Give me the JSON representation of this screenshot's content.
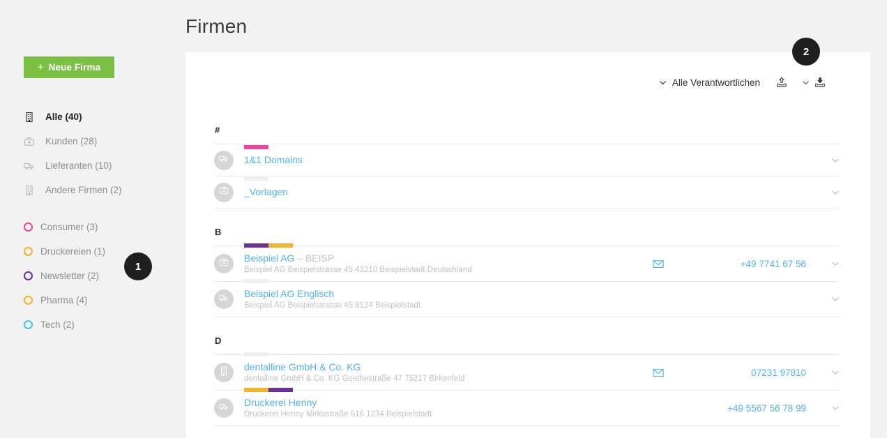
{
  "header": {
    "title": "Firmen"
  },
  "sidebar": {
    "new_button": {
      "label": "Neue Firma",
      "plus": "+",
      "color": "#7ac143"
    },
    "primary_items": [
      {
        "label": "Alle (40)",
        "icon": "building-icon",
        "active": true
      },
      {
        "label": "Kunden (28)",
        "icon": "briefcase-icon",
        "active": false
      },
      {
        "label": "Lieferanten (10)",
        "icon": "truck-icon",
        "active": false
      },
      {
        "label": "Andere Firmen (2)",
        "icon": "building-icon",
        "active": false
      }
    ],
    "tag_items": [
      {
        "label": "Consumer (3)",
        "color": "#ef44a1"
      },
      {
        "label": "Druckereien (1)",
        "color": "#f5b327"
      },
      {
        "label": "Newsletter (2)",
        "color": "#6b2fa0"
      },
      {
        "label": "Pharma (4)",
        "color": "#f5b327"
      },
      {
        "label": "Tech (2)",
        "color": "#3fc5f0"
      }
    ]
  },
  "badges": [
    {
      "label": "1",
      "name": "annotation-badge-1"
    },
    {
      "label": "2",
      "name": "annotation-badge-2"
    }
  ],
  "toolbar": {
    "responsible_filter": "Alle Verantwortlichen",
    "chevron_icon": "chevron-down-icon",
    "upload_icon": "upload-icon",
    "split_chevron_icon": "chevron-down-icon",
    "download_icon": "download-icon"
  },
  "list": {
    "groups": [
      {
        "letter": "#",
        "rows": [
          {
            "name": "1&1 Domains",
            "shortcode": "",
            "subtitle": "",
            "avatar_icon": "truck-icon",
            "tags": [
              "#ef44a1"
            ],
            "mail_icon": "",
            "phone": "",
            "chevron_icon": "chevron-down-icon"
          },
          {
            "name": "_Vorlagen",
            "shortcode": "",
            "subtitle": "",
            "avatar_icon": "briefcase-icon",
            "tags": [
              "#f0f0f0"
            ],
            "mail_icon": "",
            "phone": "",
            "chevron_icon": "chevron-down-icon"
          }
        ]
      },
      {
        "letter": "B",
        "rows": [
          {
            "name": "Beispiel AG",
            "shortcode": "– BEISP",
            "subtitle": "Beispiel AG Beispielstrasse 45 43210 Beispielstadt Deutschland",
            "avatar_icon": "briefcase-icon",
            "tags": [
              "#6b2fa0",
              "#f5b327"
            ],
            "mail_icon": "mail-icon",
            "phone": "+49 7741 67 56",
            "chevron_icon": "chevron-down-icon"
          },
          {
            "name": "Beispiel AG Englisch",
            "shortcode": "",
            "subtitle": "Beispiel AG Beispielstrasse 45 8124 Beispielstadt",
            "avatar_icon": "truck-icon",
            "tags": [
              "#f0f0f0"
            ],
            "mail_icon": "",
            "phone": "",
            "chevron_icon": "chevron-down-icon"
          }
        ]
      },
      {
        "letter": "D",
        "rows": [
          {
            "name": "dentalline GmbH & Co. KG",
            "shortcode": "",
            "subtitle": "dentalline GmbH & Co. KG Goethestraße 47 75217 Birkenfeld",
            "avatar_icon": "building-icon",
            "tags": [
              "#f0f0f0"
            ],
            "mail_icon": "mail-icon",
            "phone": "07231 97810",
            "chevron_icon": "chevron-down-icon"
          },
          {
            "name": "Druckerei Henny",
            "shortcode": "",
            "subtitle": "Druckerei Henny Mirkostraße 516 1234 Beispielstadt",
            "avatar_icon": "truck-icon",
            "tags": [
              "#f5b327",
              "#6b2fa0"
            ],
            "mail_icon": "",
            "phone": "+49 5567 56 78 99",
            "chevron_icon": "chevron-down-icon"
          }
        ]
      }
    ]
  },
  "colors": {
    "accent_green": "#7ac143",
    "link_blue": "#4eb3ef",
    "page_bg": "#f2f2f2",
    "panel_bg": "#ffffff"
  }
}
